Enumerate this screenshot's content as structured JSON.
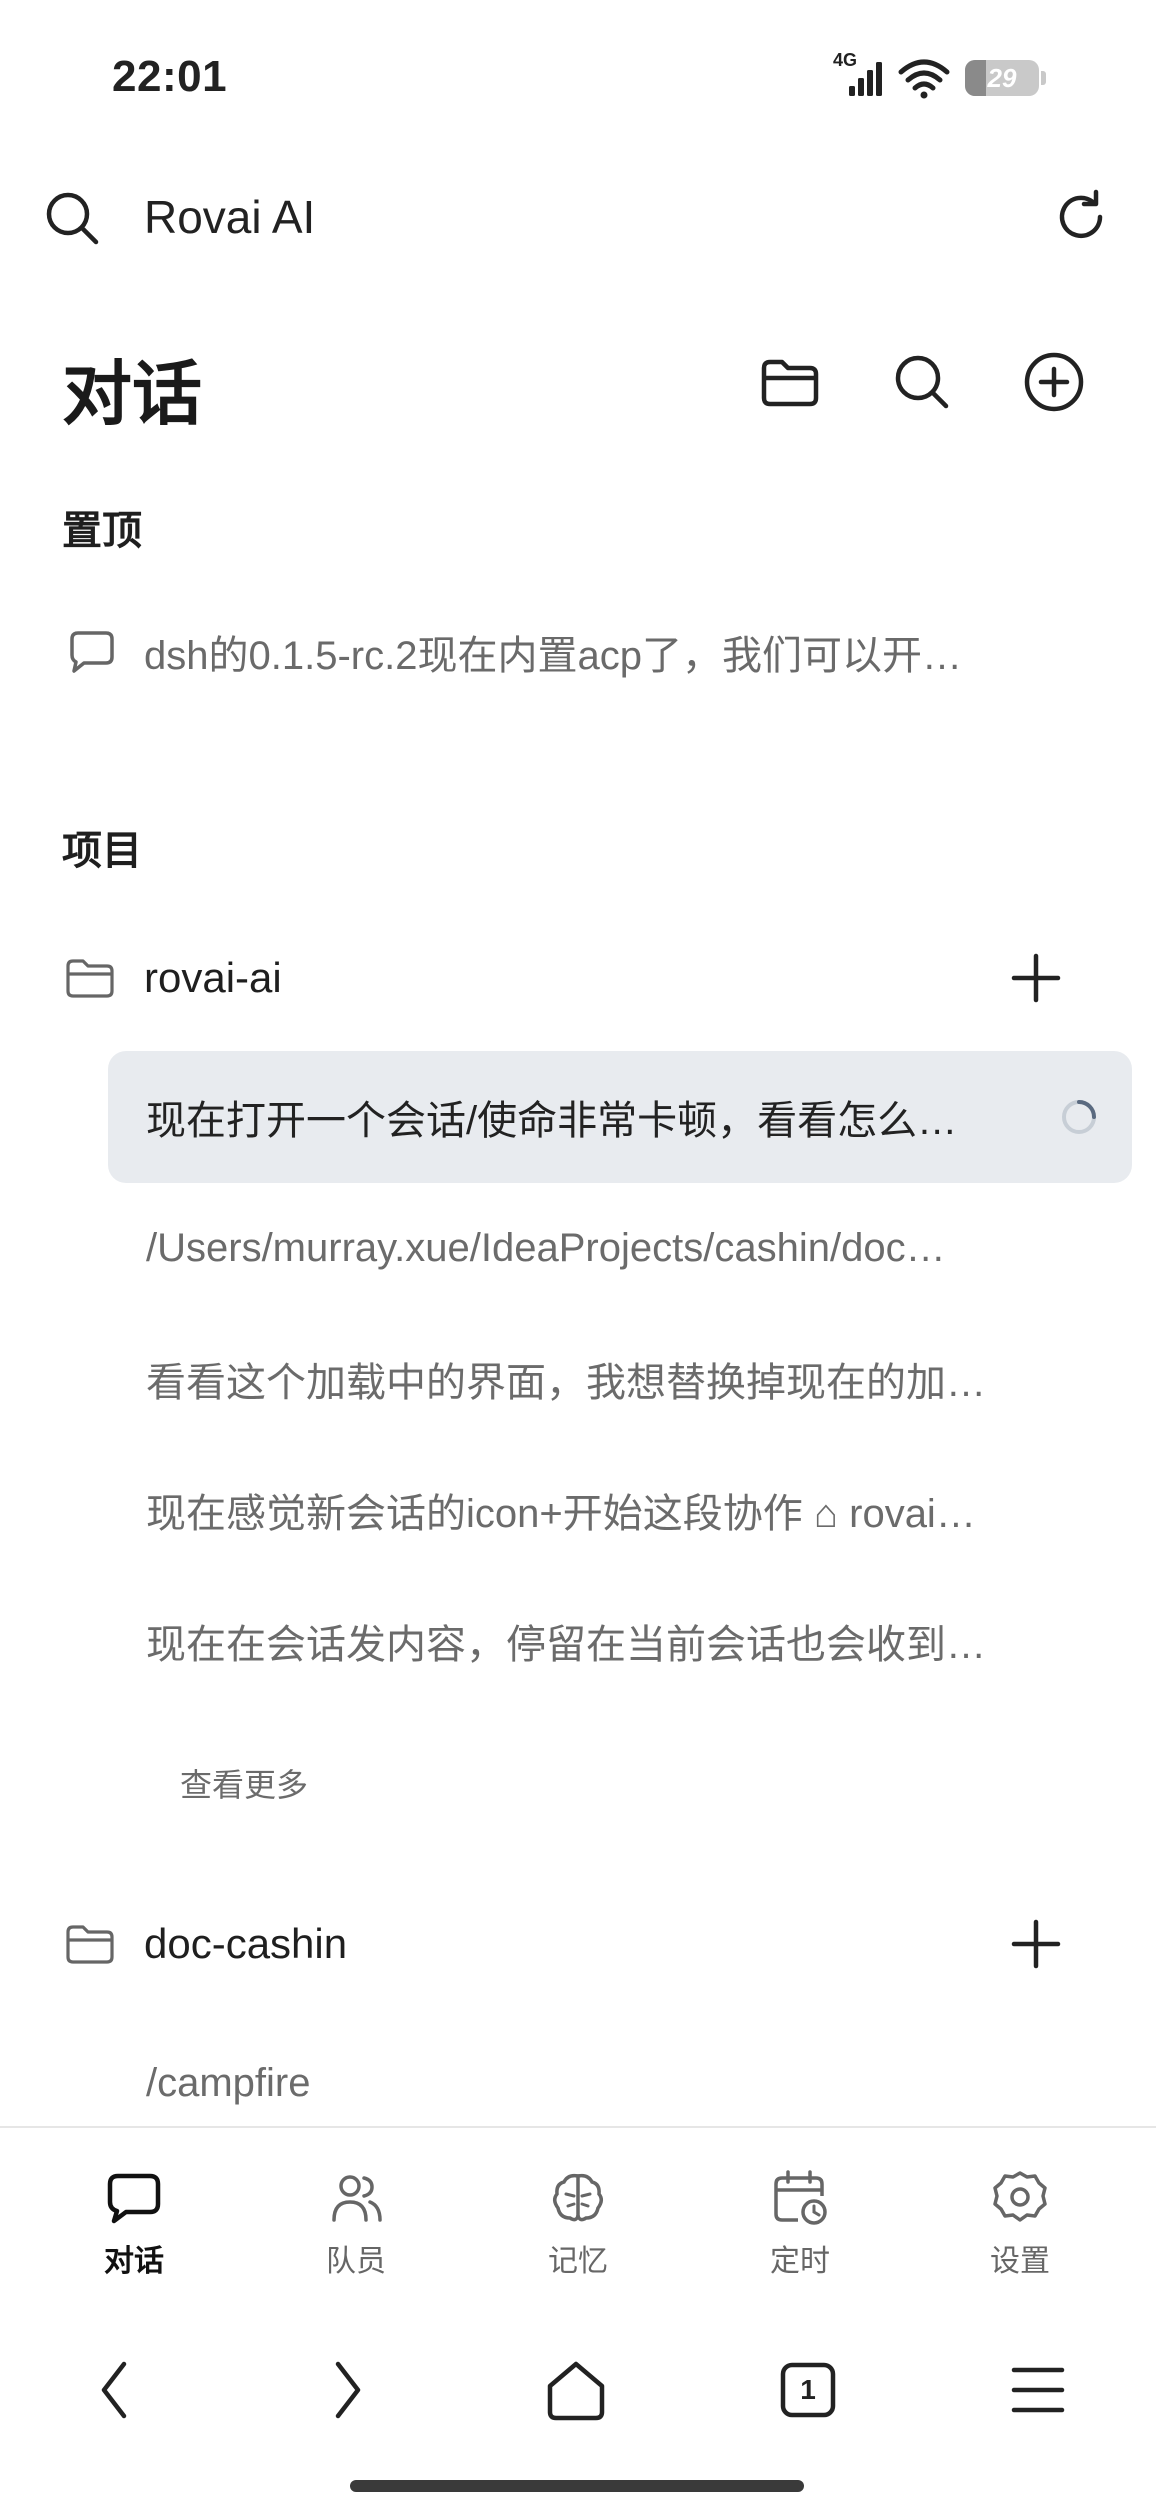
{
  "status_bar": {
    "time": "22:01",
    "network": "4G",
    "battery": "29",
    "battery_level": 0.29,
    "icons": [
      "signal-icon",
      "wifi-icon",
      "battery-icon"
    ]
  },
  "browser": {
    "address_text": "Rovai AI",
    "icons": [
      "search-icon",
      "reload-icon"
    ]
  },
  "header": {
    "title": "对话",
    "icons": [
      "folder-icon",
      "search-icon",
      "add-circle-icon"
    ]
  },
  "pinned": {
    "label": "置顶",
    "items": [
      {
        "text": "dsh的0.1.5-rc.2现在内置acp了，我们可以开…",
        "icon": "chat-bubble-icon"
      }
    ]
  },
  "projects": {
    "label": "项目",
    "groups": [
      {
        "name": "rovai-ai",
        "conversations": [
          {
            "text": "现在打开一个会话/使命非常卡顿，看看怎么…",
            "active": true,
            "loading": true
          },
          {
            "text": "/Users/murray.xue/IdeaProjects/cashin/doc…"
          },
          {
            "text": "看看这个加载中的界面，我想替换掉现在的加…"
          },
          {
            "text": "现在感觉新会话的icon+开始这段协作 ⌂ rovai…"
          },
          {
            "text": "现在在会话发内容，停留在当前会话也会收到…"
          }
        ],
        "show_more": "查看更多"
      },
      {
        "name": "doc-cashin",
        "conversations": [
          {
            "text": "/campfire"
          }
        ]
      }
    ]
  },
  "tabbar": {
    "tabs": [
      {
        "label": "对话",
        "icon": "chat-icon",
        "active": true
      },
      {
        "label": "队员",
        "icon": "team-icon"
      },
      {
        "label": "记忆",
        "icon": "brain-icon"
      },
      {
        "label": "定时",
        "icon": "calendar-clock-icon"
      },
      {
        "label": "设置",
        "icon": "gear-icon"
      }
    ]
  },
  "navbar": {
    "tab_count": "1",
    "icons": [
      "back-icon",
      "forward-icon",
      "home-icon",
      "tabs-icon",
      "menu-icon"
    ]
  },
  "colors": {
    "active_row_bg": "#e8ebef",
    "text_primary": "#1f1f1f",
    "text_secondary": "#6b6b6b"
  }
}
